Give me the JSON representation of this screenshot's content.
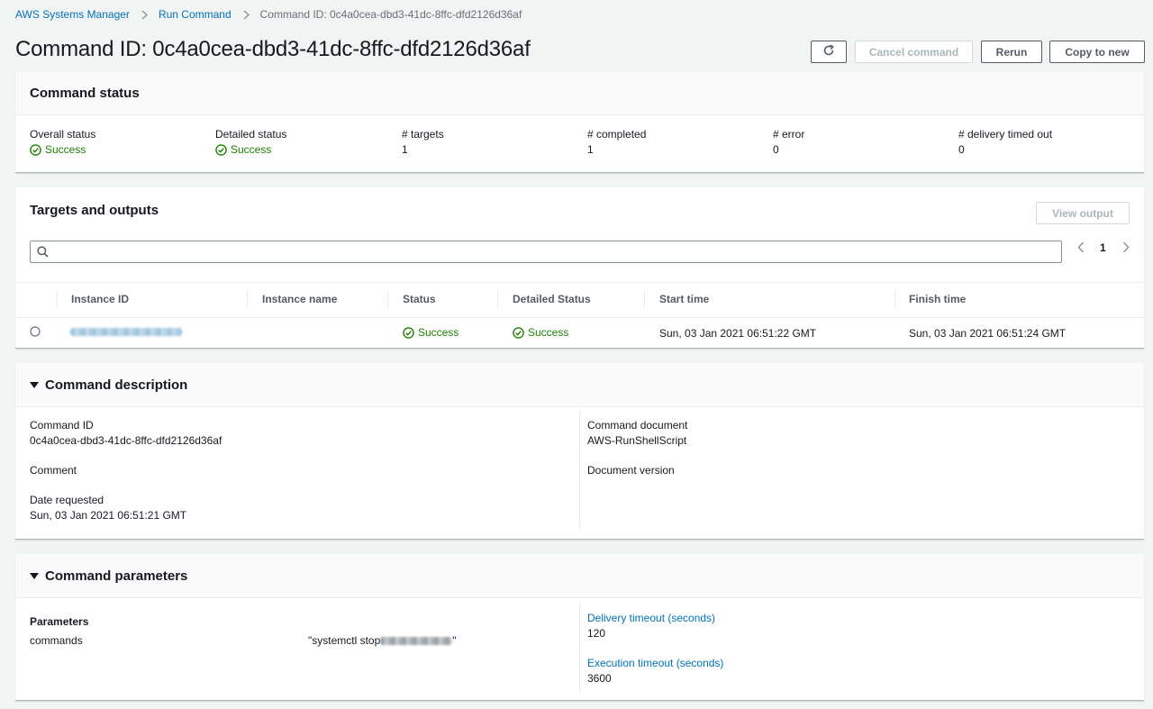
{
  "breadcrumb": {
    "items": [
      "AWS Systems Manager",
      "Run Command"
    ],
    "current": "Command ID: 0c4a0cea-dbd3-41dc-8ffc-dfd2126d36af"
  },
  "page": {
    "title": "Command ID: 0c4a0cea-dbd3-41dc-8ffc-dfd2126d36af"
  },
  "actions": {
    "cancel": "Cancel command",
    "rerun": "Rerun",
    "copy": "Copy to new"
  },
  "command_status": {
    "title": "Command status",
    "overall_label": "Overall status",
    "overall_value": "Success",
    "detailed_label": "Detailed status",
    "detailed_value": "Success",
    "targets_label": "# targets",
    "targets_value": "1",
    "completed_label": "# completed",
    "completed_value": "1",
    "error_label": "# error",
    "error_value": "0",
    "timed_out_label": "# delivery timed out",
    "timed_out_value": "0"
  },
  "targets": {
    "title": "Targets and outputs",
    "view_output": "View output",
    "search_placeholder": "",
    "page_number": "1",
    "columns": [
      "Instance ID",
      "Instance name",
      "Status",
      "Detailed Status",
      "Start time",
      "Finish time"
    ],
    "rows": [
      {
        "instance_name": "",
        "status": "Success",
        "detailed_status": "Success",
        "start_time": "Sun, 03 Jan 2021 06:51:22 GMT",
        "finish_time": "Sun, 03 Jan 2021 06:51:24 GMT"
      }
    ]
  },
  "description": {
    "title": "Command description",
    "command_id_label": "Command ID",
    "command_id_value": "0c4a0cea-dbd3-41dc-8ffc-dfd2126d36af",
    "comment_label": "Comment",
    "date_label": "Date requested",
    "date_value": "Sun, 03 Jan 2021 06:51:21 GMT",
    "document_label": "Command document",
    "document_value": "AWS-RunShellScript",
    "version_label": "Document version"
  },
  "parameters": {
    "title": "Command parameters",
    "params_label": "Parameters",
    "param_name": "commands",
    "param_value_prefix": "\"systemctl stop ",
    "param_value_suffix": "\"",
    "delivery_label": "Delivery timeout (seconds)",
    "delivery_value": "120",
    "execution_label": "Execution timeout (seconds)",
    "execution_value": "3600"
  },
  "colors": {
    "link": "#0073bb",
    "success": "#1d8102",
    "background": "#f2f3f3"
  },
  "icons": [
    "chevron-right-icon",
    "refresh-icon",
    "search-icon",
    "chevron-left-icon",
    "success-check-icon",
    "caret-down-icon",
    "radio-icon"
  ]
}
